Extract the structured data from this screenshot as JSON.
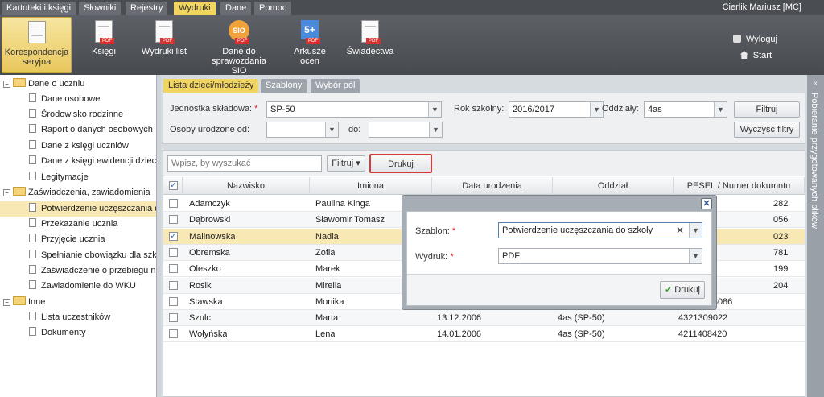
{
  "menu": {
    "tabs": [
      "Kartoteki i księgi",
      "Słowniki",
      "Rejestry",
      "Wydruki",
      "Dane",
      "Pomoc"
    ],
    "active_tab": "Wydruki",
    "user": "Cierlik Mariusz [MC]"
  },
  "ribbon": {
    "items": [
      {
        "label": "Korespondencja seryjna",
        "icon": "mail-merge-icon"
      },
      {
        "label": "Księgi",
        "icon": "books-pdf-icon"
      },
      {
        "label": "Wydruki list",
        "icon": "print-lists-icon"
      },
      {
        "label": "Dane do sprawozdania SIO",
        "icon": "sio-icon"
      },
      {
        "label": "Arkusze ocen",
        "icon": "grade-sheets-icon"
      },
      {
        "label": "Świadectwa",
        "icon": "certificates-icon"
      }
    ],
    "sio_text": "SIO",
    "arkusze_text": "5+",
    "pdf_text": "PDF",
    "logout": "Wyloguj",
    "start": "Start"
  },
  "sidebar": {
    "groups": [
      {
        "label": "Dane o uczniu",
        "items": [
          "Dane osobowe",
          "Środowisko rodzinne",
          "Raport o danych osobowych",
          "Dane z księgi uczniów",
          "Dane z księgi ewidencji dzieci",
          "Legitymacje"
        ]
      },
      {
        "label": "Zaświadczenia, zawiadomienia",
        "items": [
          "Potwierdzenie uczęszczania do",
          "Przekazanie ucznia",
          "Przyjęcie ucznia",
          "Spełnianie obowiązku dla szkół",
          "Zaświadczenie o przebiegu nau",
          "Zawiadomienie do WKU"
        ]
      },
      {
        "label": "Inne",
        "items": [
          "Lista uczestników",
          "Dokumenty"
        ]
      }
    ],
    "selected": "Potwierdzenie uczęszczania do"
  },
  "tabs": [
    "Lista dzieci/młodzieży",
    "Szablony",
    "Wybór pól"
  ],
  "filters": {
    "jednostka_label": "Jednostka składowa:",
    "jednostka_value": "SP-50",
    "rok_label": "Rok szkolny:",
    "rok_value": "2016/2017",
    "oddzialy_label": "Oddziały:",
    "oddzialy_value": "4as",
    "filtruj_btn": "Filtruj",
    "wyczysc_btn": "Wyczyść filtry",
    "urodzone_label": "Osoby urodzone od:",
    "do_label": "do:",
    "req": "*"
  },
  "grid": {
    "search_placeholder": "Wpisz, by wyszukać",
    "filtruj": "Filtruj ▾",
    "drukuj": "Drukuj",
    "columns": [
      "Nazwisko",
      "Imiona",
      "Data urodzenia",
      "Oddział",
      "PESEL / Numer dokumntu"
    ],
    "rows": [
      {
        "nazwisko": "Adamczyk",
        "imiona": "Paulina Kinga",
        "data": "",
        "oddzial": "",
        "pesel": "282"
      },
      {
        "nazwisko": "Dąbrowski",
        "imiona": "Sławomir Tomasz",
        "data": "",
        "oddzial": "",
        "pesel": "056"
      },
      {
        "nazwisko": "Malinowska",
        "imiona": "Nadia",
        "data": "",
        "oddzial": "",
        "pesel": "023"
      },
      {
        "nazwisko": "Obremska",
        "imiona": "Zofia",
        "data": "",
        "oddzial": "",
        "pesel": "781"
      },
      {
        "nazwisko": "Oleszko",
        "imiona": "Marek",
        "data": "",
        "oddzial": "",
        "pesel": "199"
      },
      {
        "nazwisko": "Rosik",
        "imiona": "Mirella",
        "data": "",
        "oddzial": "",
        "pesel": "204"
      },
      {
        "nazwisko": "Stawska",
        "imiona": "Monika",
        "data": "21.12.2006",
        "oddzial": "",
        "pesel": "03322108086"
      },
      {
        "nazwisko": "Szulc",
        "imiona": "Marta",
        "data": "13.12.2006",
        "oddzial": "4as (SP-50)",
        "pesel": "4321309022"
      },
      {
        "nazwisko": "Wołyńska",
        "imiona": "Lena",
        "data": "14.01.2006",
        "oddzial": "4as (SP-50)",
        "pesel": "4211408420"
      }
    ],
    "checked_row": 2,
    "check_mark": "✓"
  },
  "right_panel": {
    "label": "Pobieranie przygotowanych plików",
    "chevron": "«"
  },
  "modal": {
    "szablon_label": "Szablon:",
    "szablon_value": "Potwierdzenie uczęszczania do szkoły",
    "wydruk_label": "Wydruk:",
    "wydruk_value": "PDF",
    "drukuj": "Drukuj",
    "close": "✕",
    "req": "*"
  }
}
